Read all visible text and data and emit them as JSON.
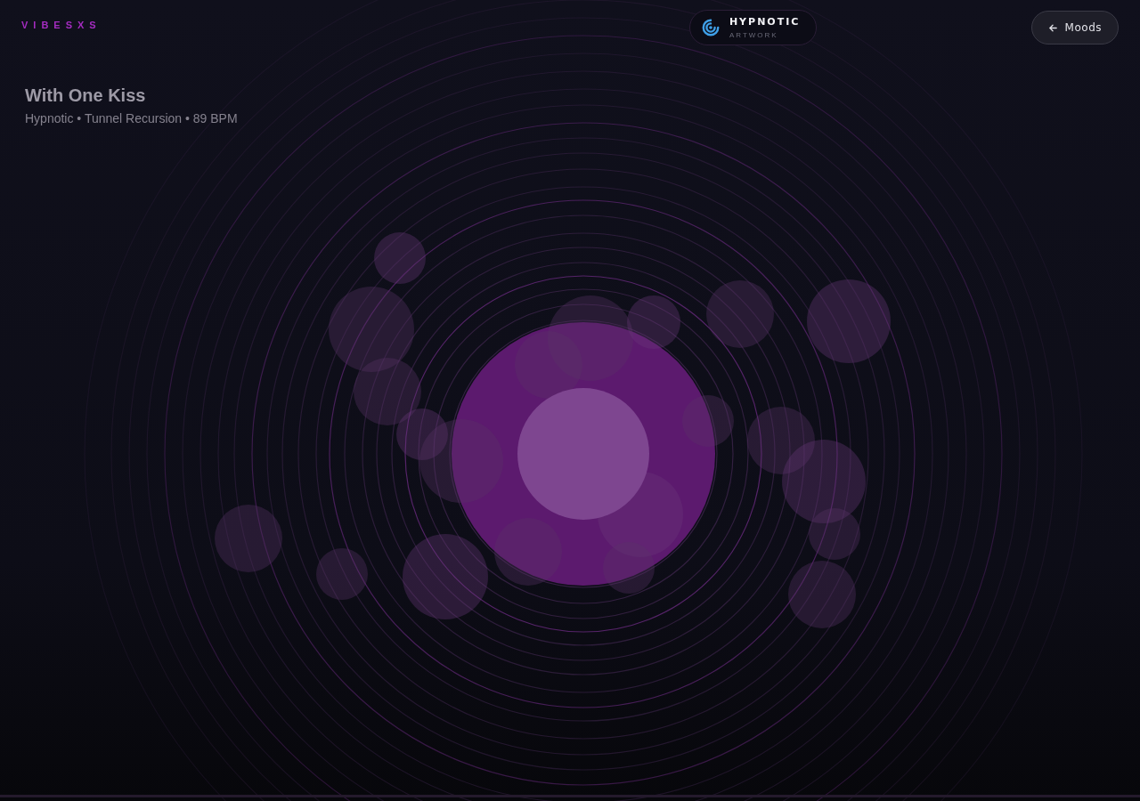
{
  "brand": "VIBESXS",
  "badge": {
    "title": "HYPNOTIC",
    "subtitle": "ARTWORK"
  },
  "back_button": {
    "label": "Moods"
  },
  "track": {
    "title": "With One Kiss",
    "meta": "Hypnotic • Tunnel Recursion • 89 BPM"
  }
}
